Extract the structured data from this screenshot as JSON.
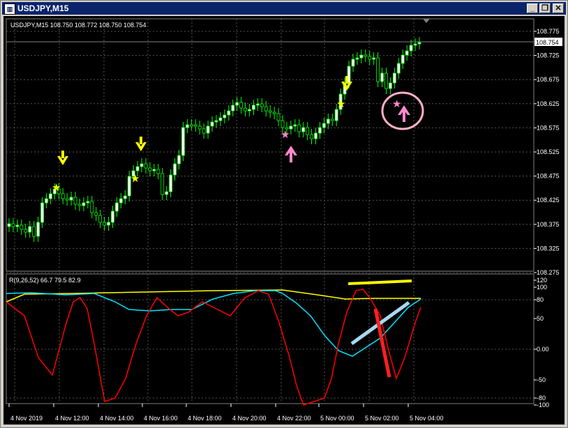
{
  "window": {
    "title": "USDJPY,M15",
    "icon": "chart-window-icon",
    "controls": [
      "minimize-icon",
      "restore-icon",
      "close-icon"
    ]
  },
  "main_panel": {
    "header": "USDJPY,M15  108.750 108.772 108.750 108.754",
    "current_price": "108.754",
    "price_ticks": [
      "108.775",
      "108.725",
      "108.675",
      "108.625",
      "108.575",
      "108.525",
      "108.475",
      "108.425",
      "108.375",
      "108.325",
      "108.275"
    ]
  },
  "indicator_panel": {
    "header": "R(9,26,52) 66.7 79.5 82.9",
    "ticks": [
      "120",
      "100",
      "80",
      "50",
      "0.00",
      "-50",
      "-80",
      "-100"
    ]
  },
  "time_axis": [
    "4 Nov 2019",
    "4 Nov 12:00",
    "4 Nov 14:00",
    "4 Nov 16:00",
    "4 Nov 18:00",
    "4 Nov 20:00",
    "4 Nov 22:00",
    "5 Nov 00:00",
    "5 Nov 02:00",
    "5 Nov 04:00"
  ],
  "colors": {
    "background": "#000000",
    "bull_candle": "#ffffff",
    "bear_candle": "#000000",
    "wick": "#00ff00",
    "grid": "#606060",
    "sell_arrow": "#ffff00",
    "star_yellow": "#ffff00",
    "buy_marker": "#ff88cc",
    "line_red": "#ff0000",
    "line_cyan": "#00e5ff",
    "line_yellow": "#ffff00"
  }
}
